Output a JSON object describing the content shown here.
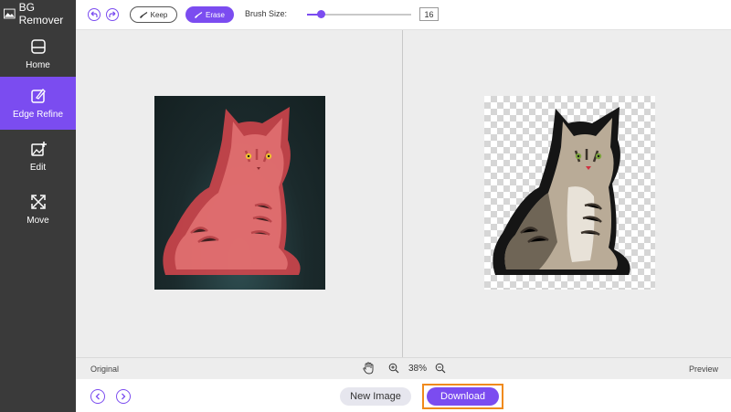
{
  "app": {
    "title": "BG Remover"
  },
  "sidebar": {
    "items": [
      {
        "label": "Home",
        "icon": "home-icon"
      },
      {
        "label": "Edge Refine",
        "icon": "edge-refine-icon",
        "active": true
      },
      {
        "label": "Edit",
        "icon": "edit-image-icon"
      },
      {
        "label": "Move",
        "icon": "move-icon"
      }
    ]
  },
  "toolbar": {
    "keep_label": "Keep",
    "erase_label": "Erase",
    "brush_size_label": "Brush Size:",
    "brush_size_value": "16",
    "brush_slider_fraction": 0.13
  },
  "statusbar": {
    "original_label": "Original",
    "preview_label": "Preview",
    "zoom_text": "38%"
  },
  "footer": {
    "new_image_label": "New Image",
    "download_label": "Download"
  },
  "colors": {
    "accent": "#7b4cf0",
    "sidebar_bg": "#3a3a3a",
    "highlight_border": "#f08a1c"
  }
}
